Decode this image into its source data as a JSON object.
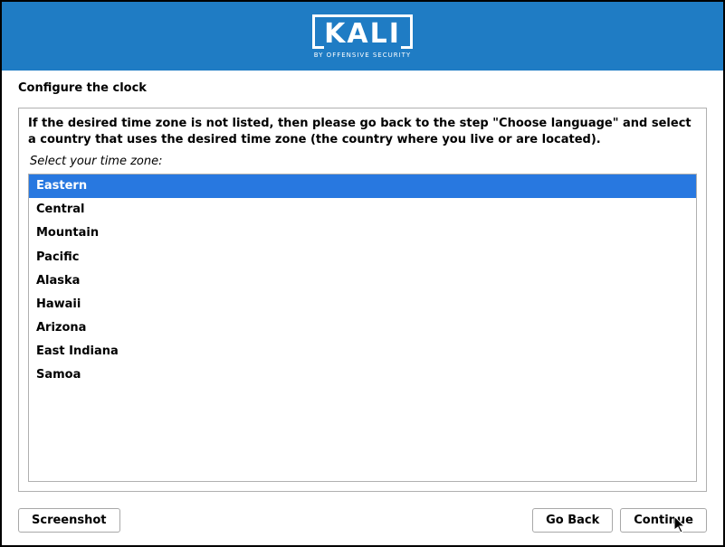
{
  "header": {
    "brand": "KALI",
    "tagline": "BY OFFENSIVE SECURITY"
  },
  "page": {
    "title": "Configure the clock",
    "instructions": "If the desired time zone is not listed, then please go back to the step \"Choose language\" and select a country that uses the desired time zone (the country where you live or are located).",
    "prompt": "Select your time zone:"
  },
  "timezones": {
    "selected_index": 0,
    "items": [
      "Eastern",
      "Central",
      "Mountain",
      "Pacific",
      "Alaska",
      "Hawaii",
      "Arizona",
      "East Indiana",
      "Samoa"
    ]
  },
  "footer": {
    "screenshot": "Screenshot",
    "go_back": "Go Back",
    "continue": "Continue"
  }
}
